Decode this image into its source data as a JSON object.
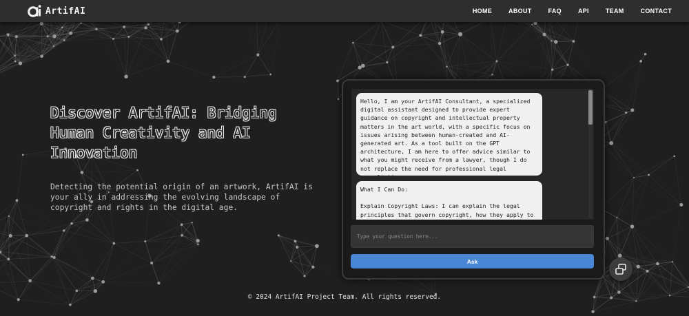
{
  "brand": {
    "name": "ArtifAI",
    "logo_icon": "artifai-logo-icon"
  },
  "nav": {
    "links": [
      "HOME",
      "ABOUT",
      "FAQ",
      "API",
      "TEAM",
      "CONTACT"
    ]
  },
  "hero": {
    "title": "Discover ArtifAI: Bridging Human Creativity and AI Innovation",
    "description": "Detecting the potential origin of an artwork, ArtifAI is your ally in addressing the evolving landscape of copyright and rights in the digital age."
  },
  "chat": {
    "messages": [
      "Hello, I am your ArtifAI Consultant, a specialized digital assistant designed to provide expert guidance on copyright and intellectual property matters in the art world, with a specific focus on issues arising between human-created and AI-generated art. As a tool built on the GPT architecture, I am here to offer advice similar to what you might receive from a lawyer, though I do not replace the need for professional legal consultation.",
      "What I Can Do:\n\nExplain Copyright Laws: I can explain the legal principles that govern copyright, how they apply to"
    ],
    "input_placeholder": "Type your question here...",
    "ask_label": "Ask"
  },
  "float_button": {
    "icon": "window-restore-icon"
  },
  "footer": {
    "text": "© 2024 ArtifAI Project Team. All rights reserved."
  },
  "colors": {
    "background": "#1f1f1f",
    "navbar": "#2e2e2e",
    "accent": "#4a86d6",
    "bubble": "#f0f0f0"
  }
}
